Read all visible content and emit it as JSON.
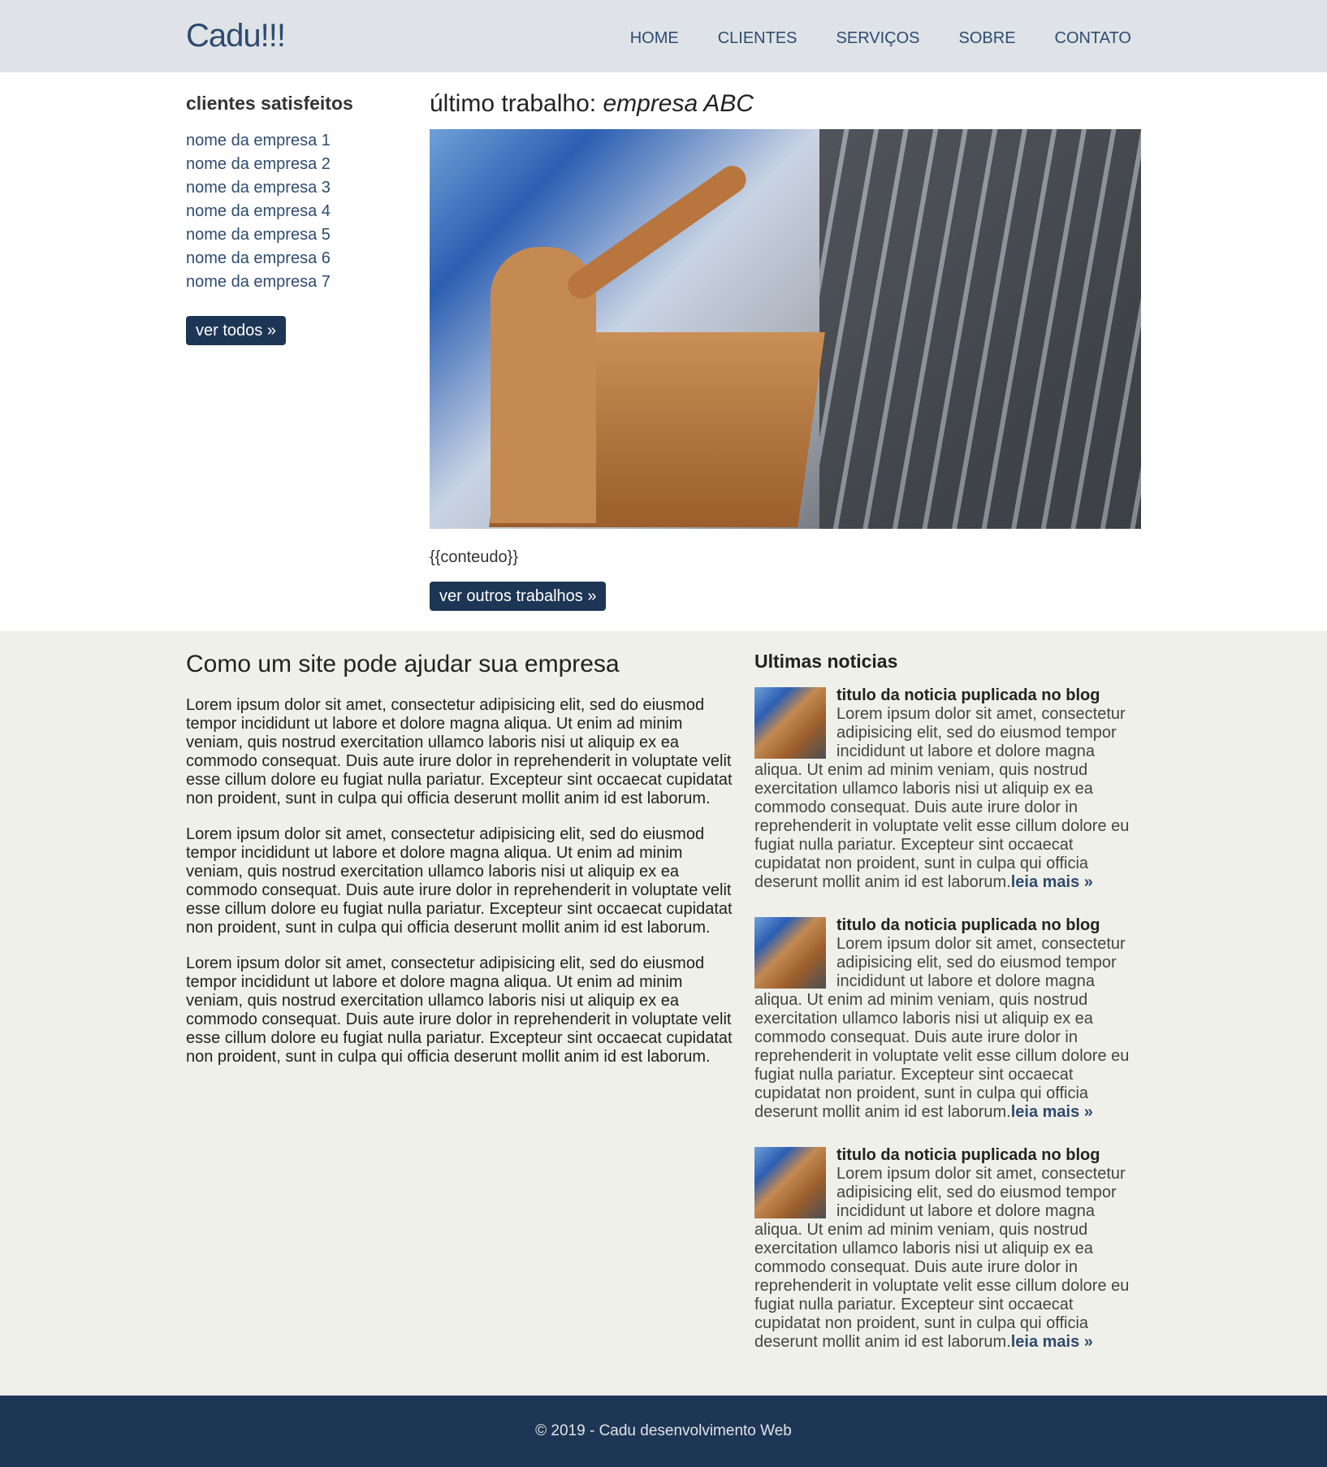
{
  "header": {
    "logo": "Cadu!!!",
    "nav": [
      "HOME",
      "CLIENTES",
      "SERVIÇOS",
      "SOBRE",
      "CONTATO"
    ]
  },
  "sidebar": {
    "title": "clientes satisfeitos",
    "items": [
      "nome da empresa 1",
      "nome da empresa 2",
      "nome da empresa 3",
      "nome da empresa 4",
      "nome da empresa 5",
      "nome da empresa 6",
      "nome da empresa 7"
    ],
    "button": "ver todos »"
  },
  "main": {
    "title_prefix": "último trabalho: ",
    "title_company": "empresa ABC",
    "content": "{{conteudo}}",
    "button": "ver outros trabalhos »"
  },
  "article": {
    "title": "Como um site pode ajudar sua empresa",
    "paragraphs": [
      "Lorem ipsum dolor sit amet, consectetur adipisicing elit, sed do eiusmod tempor incididunt ut labore et dolore magna aliqua. Ut enim ad minim veniam, quis nostrud exercitation ullamco laboris nisi ut aliquip ex ea commodo consequat. Duis aute irure dolor in reprehenderit in voluptate velit esse cillum dolore eu fugiat nulla pariatur. Excepteur sint occaecat cupidatat non proident, sunt in culpa qui officia deserunt mollit anim id est laborum.",
      "Lorem ipsum dolor sit amet, consectetur adipisicing elit, sed do eiusmod tempor incididunt ut labore et dolore magna aliqua. Ut enim ad minim veniam, quis nostrud exercitation ullamco laboris nisi ut aliquip ex ea commodo consequat. Duis aute irure dolor in reprehenderit in voluptate velit esse cillum dolore eu fugiat nulla pariatur. Excepteur sint occaecat cupidatat non proident, sunt in culpa qui officia deserunt mollit anim id est laborum.",
      "Lorem ipsum dolor sit amet, consectetur adipisicing elit, sed do eiusmod tempor incididunt ut labore et dolore magna aliqua. Ut enim ad minim veniam, quis nostrud exercitation ullamco laboris nisi ut aliquip ex ea commodo consequat. Duis aute irure dolor in reprehenderit in voluptate velit esse cillum dolore eu fugiat nulla pariatur. Excepteur sint occaecat cupidatat non proident, sunt in culpa qui officia deserunt mollit anim id est laborum."
    ]
  },
  "news": {
    "title": "Ultimas noticias",
    "items": [
      {
        "title": "titulo da noticia puplicada no blog",
        "body": "Lorem ipsum dolor sit amet, consectetur adipisicing elit, sed do eiusmod tempor incididunt ut labore et dolore magna aliqua. Ut enim ad minim veniam, quis nostrud exercitation ullamco laboris nisi ut aliquip ex ea commodo consequat. Duis aute irure dolor in reprehenderit in voluptate velit esse cillum dolore eu fugiat nulla pariatur. Excepteur sint occaecat cupidatat non proident, sunt in culpa qui officia deserunt mollit anim id est laborum.",
        "more": "leia mais »"
      },
      {
        "title": "titulo da noticia puplicada no blog",
        "body": "Lorem ipsum dolor sit amet, consectetur adipisicing elit, sed do eiusmod tempor incididunt ut labore et dolore magna aliqua. Ut enim ad minim veniam, quis nostrud exercitation ullamco laboris nisi ut aliquip ex ea commodo consequat. Duis aute irure dolor in reprehenderit in voluptate velit esse cillum dolore eu fugiat nulla pariatur. Excepteur sint occaecat cupidatat non proident, sunt in culpa qui officia deserunt mollit anim id est laborum.",
        "more": "leia mais »"
      },
      {
        "title": "titulo da noticia puplicada no blog",
        "body": "Lorem ipsum dolor sit amet, consectetur adipisicing elit, sed do eiusmod tempor incididunt ut labore et dolore magna aliqua. Ut enim ad minim veniam, quis nostrud exercitation ullamco laboris nisi ut aliquip ex ea commodo consequat. Duis aute irure dolor in reprehenderit in voluptate velit esse cillum dolore eu fugiat nulla pariatur. Excepteur sint occaecat cupidatat non proident, sunt in culpa qui officia deserunt mollit anim id est laborum.",
        "more": "leia mais »"
      }
    ]
  },
  "footer": {
    "text": "© 2019 - Cadu desenvolvimento Web"
  },
  "colors": {
    "header_bg": "#dfe3e7",
    "brand": "#2e4b6f",
    "button_bg": "#1e3655",
    "band_bg": "#f0f0ea",
    "footer_bg": "#1e3655"
  }
}
